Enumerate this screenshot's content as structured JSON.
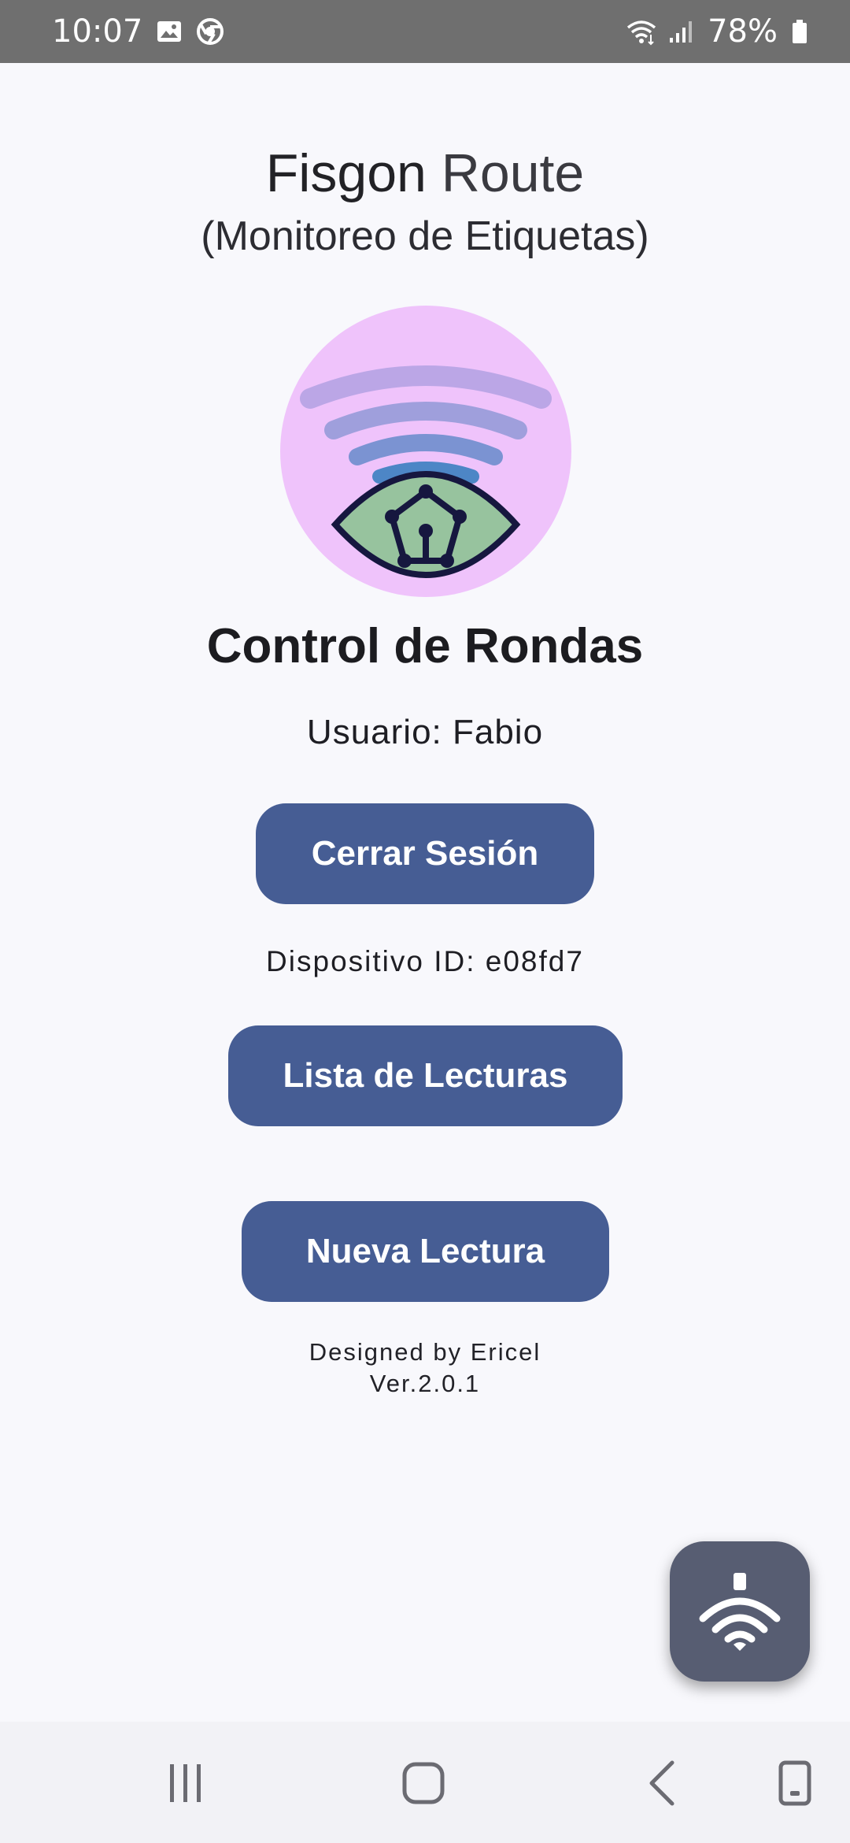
{
  "status_bar": {
    "time": "10:07",
    "battery": "78%",
    "icons": [
      "gallery-icon",
      "chrome-icon",
      "wifi-icon",
      "signal-icon",
      "battery-icon"
    ]
  },
  "header": {
    "title_part1": "Fisgon",
    "title_part2": "Route",
    "subtitle": "(Monitoreo de Etiquetas)"
  },
  "logo": {
    "icon": "rfid-eye-logo",
    "colors": {
      "circle": "#efc3fb",
      "wave1": "#bba6e6",
      "wave2": "#9f9fdc",
      "wave3": "#7b93d2",
      "wave4": "#4d86c6",
      "eye_fill": "#97c39e",
      "outline": "#16173f"
    }
  },
  "main": {
    "heading": "Control de Rondas",
    "user_text": "Usuario: Fabio",
    "logout_label": "Cerrar Sesión",
    "device_text": "Dispositivo ID: e08fd7",
    "list_label": "Lista de Lecturas",
    "new_label": "Nueva Lectura",
    "credit_line1": "Designed by Ericel",
    "credit_line2": "Ver.2.0.1"
  },
  "fab": {
    "icon": "nfc-scan-icon"
  },
  "nav_bar": {
    "icons": [
      "recents-icon",
      "home-icon",
      "back-icon",
      "rotate-icon"
    ]
  },
  "theme": {
    "button_color": "#465d94",
    "fab_color": "#575d72",
    "background": "#f8f8fc"
  }
}
